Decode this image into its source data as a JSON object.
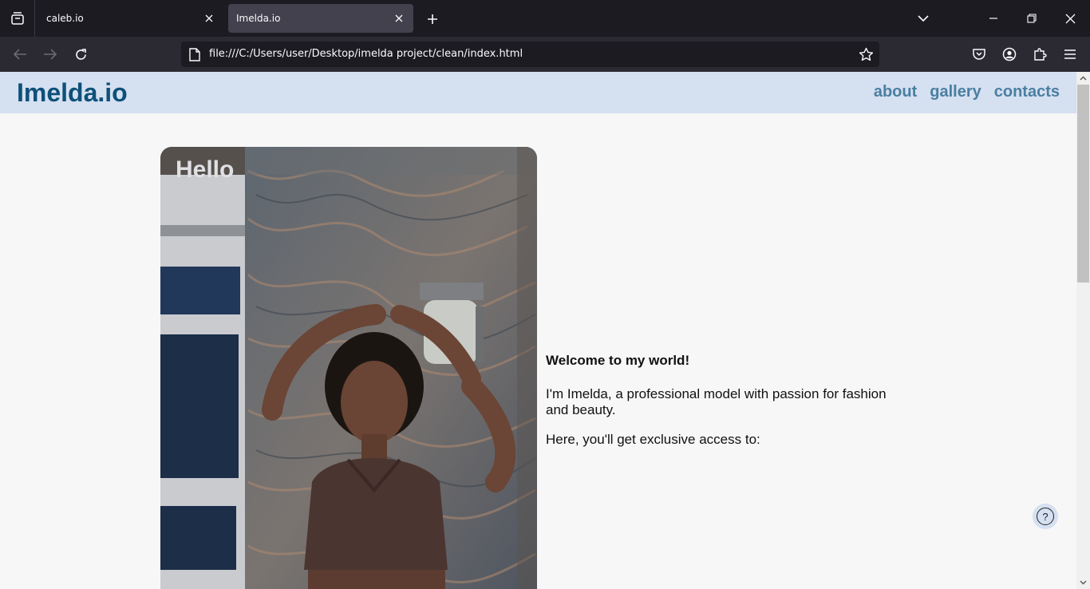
{
  "browser": {
    "tabs": [
      {
        "title": "caleb.io",
        "active": false
      },
      {
        "title": "Imelda.io",
        "active": true
      }
    ],
    "url": "file:///C:/Users/user/Desktop/imelda project/clean/index.html"
  },
  "site": {
    "logo": "Imelda.io",
    "nav": [
      "about",
      "gallery",
      "contacts"
    ],
    "hero_heading": "Hello",
    "welcome": "Welcome to my world!",
    "intro_paragraph": "I'm Imelda, a professional model with passion for fashion and beauty.",
    "access_text": "Here, you'll get exclusive access to:",
    "help_label": "?"
  },
  "colors": {
    "header_bg": "#d5e0f1",
    "logo": "#0e5078",
    "nav_link": "#4a7fa0",
    "page_bg": "#f7f7f7"
  }
}
